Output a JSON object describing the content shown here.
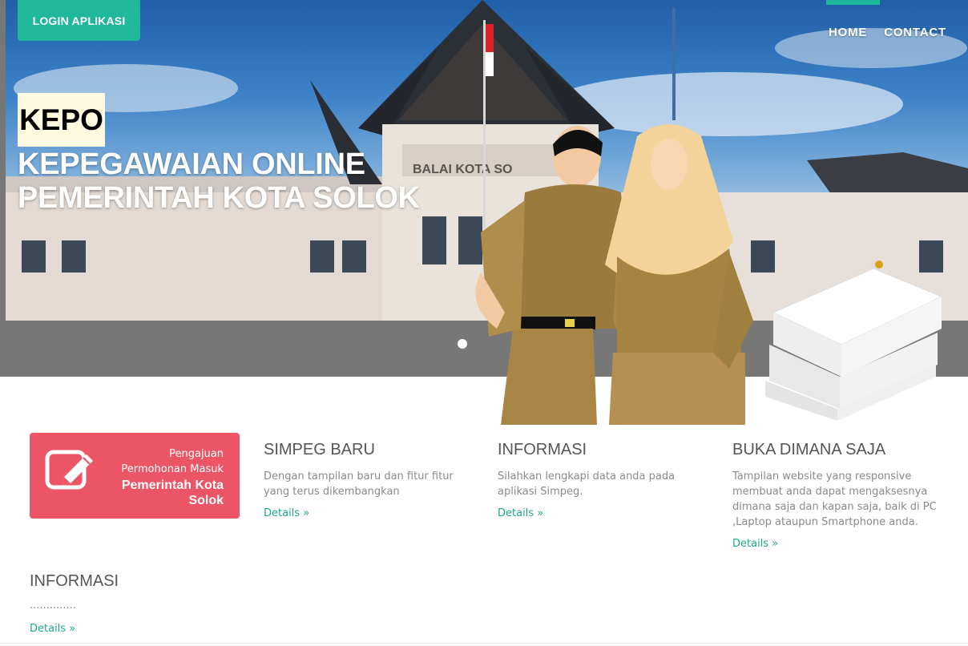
{
  "header": {
    "login_label": "LOGIN APLIKASI",
    "nav": [
      {
        "label": "HOME"
      },
      {
        "label": "CONTACT"
      }
    ]
  },
  "hero": {
    "badge": "KEPO",
    "title_line1": "KEPEGAWAIAN ONLINE",
    "title_line2": "PEMERINTAH KOTA SOLOK",
    "building_sign": "BALAI KOTA SO"
  },
  "feature_box": {
    "line1": "Pengajuan",
    "line2": "Permohonan Masuk",
    "line3": "Pemerintah Kota",
    "line4": "Solok",
    "icon": "edit-icon",
    "color": "#eb5565"
  },
  "columns": [
    {
      "title": "SIMPEG BARU",
      "text": "Dengan tampilan baru dan fitur fitur yang terus dikembangkan",
      "link": "Details »"
    },
    {
      "title": "INFORMASI",
      "text": "Silahkan lengkapi data anda pada aplikasi Simpeg.",
      "link": "Details »"
    },
    {
      "title": "BUKA DIMANA SAJA",
      "text": "Tampilan website yang responsive membuat anda dapat mengaksesnya dimana saja dan kapan saja, baik di PC ,Laptop ataupun Smartphone anda.",
      "link": "Details »"
    }
  ],
  "info": {
    "title": "INFORMASI",
    "dots": "..............",
    "link": "Details »"
  },
  "colors": {
    "accent": "#1fb89a",
    "link": "#1fa68a",
    "feature": "#eb5565",
    "hero_band": "#777777"
  }
}
